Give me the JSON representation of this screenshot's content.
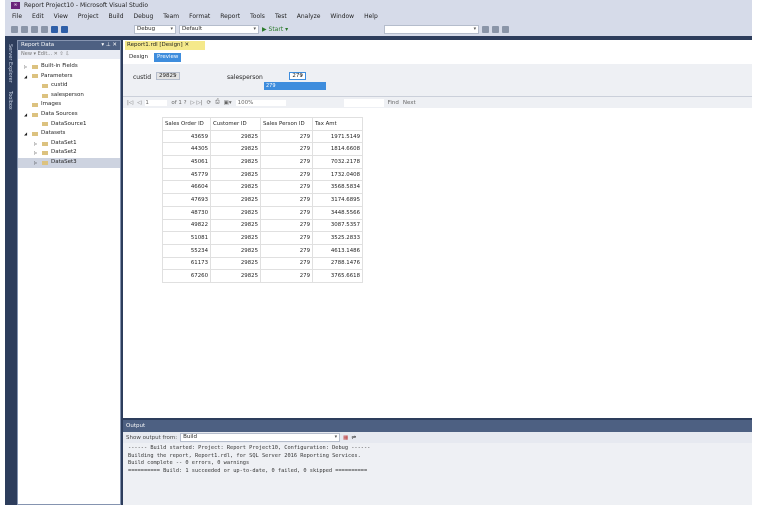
{
  "window": {
    "title": "Report Project10 - Microsoft Visual Studio"
  },
  "menu": [
    "File",
    "Edit",
    "View",
    "Project",
    "Build",
    "Debug",
    "Team",
    "Format",
    "Report",
    "Tools",
    "Test",
    "Analyze",
    "Window",
    "Help"
  ],
  "toolbar": {
    "config": "Debug",
    "platform": "Default",
    "start": "▶ Start ▾"
  },
  "side_strip": {
    "server_explorer": "Server Explorer",
    "toolbox": "Toolbox"
  },
  "report_data": {
    "title": "Report Data",
    "tools": "New ▾  Edit...  ✕  ⇧  ⇩",
    "items": [
      {
        "label": "Built-in Fields",
        "level": 0,
        "arrow": "▷"
      },
      {
        "label": "Parameters",
        "level": 0,
        "arrow": "◢"
      },
      {
        "label": "custid",
        "level": 1,
        "arrow": ""
      },
      {
        "label": "salesperson",
        "level": 1,
        "arrow": ""
      },
      {
        "label": "Images",
        "level": 0,
        "arrow": ""
      },
      {
        "label": "Data Sources",
        "level": 0,
        "arrow": "◢"
      },
      {
        "label": "DataSource1",
        "level": 1,
        "arrow": ""
      },
      {
        "label": "Datasets",
        "level": 0,
        "arrow": "◢"
      },
      {
        "label": "DataSet1",
        "level": 1,
        "arrow": "▷"
      },
      {
        "label": "DataSet2",
        "level": 1,
        "arrow": "▷"
      },
      {
        "label": "DataSet3",
        "level": 1,
        "arrow": "▷",
        "selected": true
      }
    ]
  },
  "doc_tab": {
    "label": "Report1.rdl [Design]",
    "close": "✕"
  },
  "view_tabs": {
    "design": "Design",
    "preview": "Preview"
  },
  "params": {
    "custid_label": "custid",
    "custid_value": "29825",
    "salesperson_label": "salesperson",
    "salesperson_value": "279",
    "dropdown_option": "279"
  },
  "report_toolbar": {
    "page": "1",
    "of": "of 1 ?",
    "zoom": "100%",
    "find": "Find",
    "next": "Next"
  },
  "table": {
    "headers": [
      "Sales Order ID",
      "Customer ID",
      "Sales Person ID",
      "Tax Amt"
    ],
    "rows": [
      [
        "43659",
        "29825",
        "279",
        "1971.5149"
      ],
      [
        "44305",
        "29825",
        "279",
        "1814.6608"
      ],
      [
        "45061",
        "29825",
        "279",
        "7032.2178"
      ],
      [
        "45779",
        "29825",
        "279",
        "1732.0408"
      ],
      [
        "46604",
        "29825",
        "279",
        "3568.5834"
      ],
      [
        "47693",
        "29825",
        "279",
        "3174.6895"
      ],
      [
        "48730",
        "29825",
        "279",
        "3448.5566"
      ],
      [
        "49822",
        "29825",
        "279",
        "3087.5357"
      ],
      [
        "51081",
        "29825",
        "279",
        "3525.2833"
      ],
      [
        "55234",
        "29825",
        "279",
        "4613.1486"
      ],
      [
        "61173",
        "29825",
        "279",
        "2788.1476"
      ],
      [
        "67260",
        "29825",
        "279",
        "3765.6618"
      ]
    ]
  },
  "output": {
    "title": "Output",
    "show_from_label": "Show output from:",
    "show_from_value": "Build",
    "lines": [
      "------ Build started: Project: Report Project10, Configuration: Debug ------",
      "Building the report, Report1.rdl, for SQL Server 2016 Reporting Services.",
      "Build complete -- 0 errors, 0 warnings",
      "========== Build: 1 succeeded or up-to-date, 0 failed, 0 skipped =========="
    ]
  }
}
